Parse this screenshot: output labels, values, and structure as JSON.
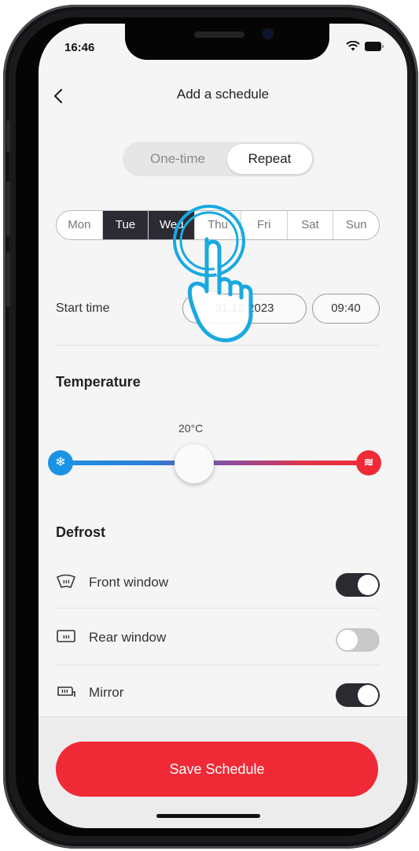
{
  "status_bar": {
    "time": "16:46"
  },
  "header": {
    "title": "Add a schedule"
  },
  "mode": {
    "one_time": "One-time",
    "repeat": "Repeat",
    "selected": "Repeat"
  },
  "days": [
    {
      "label": "Mon",
      "selected": false
    },
    {
      "label": "Tue",
      "selected": true
    },
    {
      "label": "Wed",
      "selected": true
    },
    {
      "label": "Thu",
      "selected": false
    },
    {
      "label": "Fri",
      "selected": false
    },
    {
      "label": "Sat",
      "selected": false
    },
    {
      "label": "Sun",
      "selected": false
    }
  ],
  "start": {
    "label": "Start time",
    "date": "31.12.2023",
    "time": "09:40"
  },
  "temperature": {
    "title": "Temperature",
    "value": "20°C",
    "cold_icon": "snowflake-icon",
    "hot_icon": "heat-waves-icon"
  },
  "defrost": {
    "title": "Defrost",
    "items": [
      {
        "label": "Front window",
        "on": true,
        "icon": "front-window-defrost-icon"
      },
      {
        "label": "Rear window",
        "on": false,
        "icon": "rear-window-defrost-icon"
      },
      {
        "label": "Mirror",
        "on": true,
        "icon": "mirror-defrost-icon"
      }
    ]
  },
  "save_button": {
    "label": "Save Schedule"
  },
  "colors": {
    "accent_red": "#ef2a36",
    "dark": "#2c2a33",
    "cold_blue": "#1a93e6",
    "tap_cyan": "#19a9e0"
  }
}
